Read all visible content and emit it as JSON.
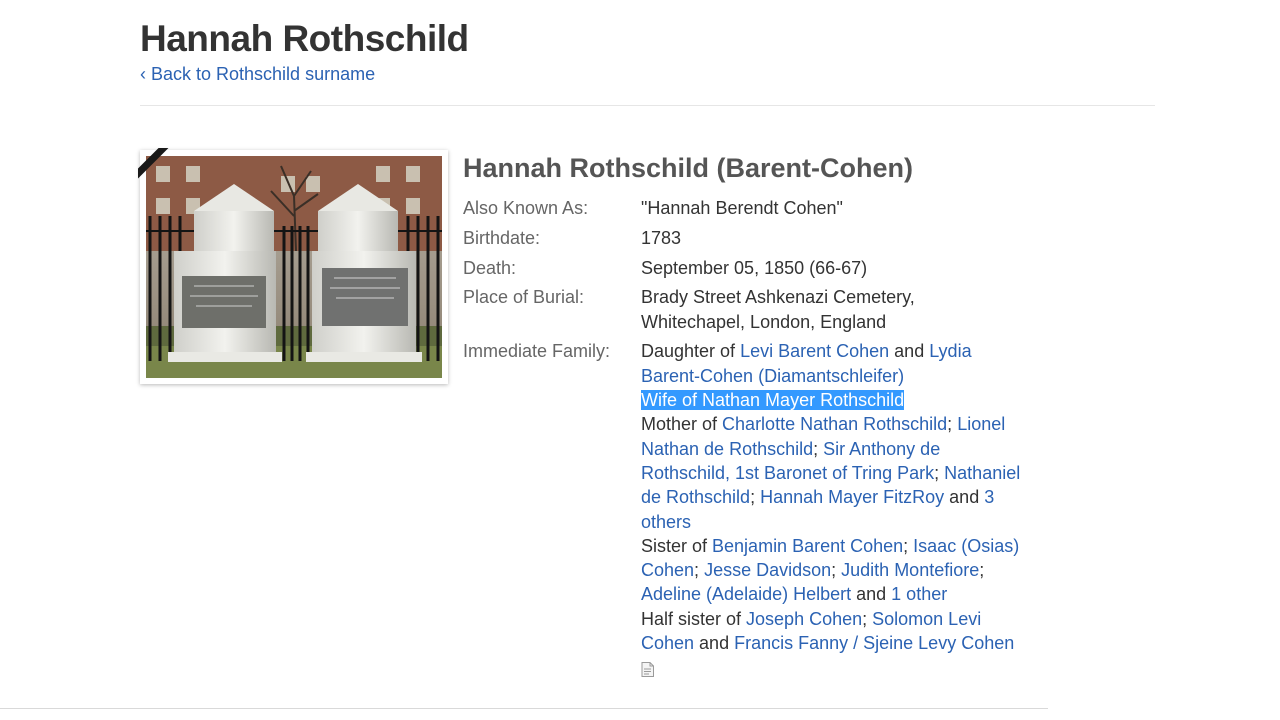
{
  "header": {
    "title": "Hannah Rothschild",
    "back_link": "‹ Back to Rothschild surname"
  },
  "profile": {
    "name": "Hannah Rothschild (Barent-Cohen)",
    "photo_icon": "gravestone-photo",
    "also_known_as_label": "Also Known As:",
    "also_known_as": "\"Hannah Berendt Cohen\"",
    "birthdate_label": "Birthdate:",
    "birthdate": "1783",
    "death_label": "Death:",
    "death": "September 05, 1850 (66-67)",
    "burial_label": "Place of Burial:",
    "burial_line1": "Brady Street Ashkenazi Cemetery,",
    "burial_line2": "Whitechapel, London, England",
    "family_label": "Immediate Family:"
  },
  "family": {
    "daughter_of": "Daughter of ",
    "parent1": "Levi Barent Cohen",
    "and1": " and ",
    "parent2": "Lydia Barent-Cohen (Diamantschleifer)",
    "wife_of": "Wife of Nathan Mayer Rothschild",
    "mother_of": "Mother of ",
    "child1": "Charlotte Nathan Rothschild",
    "sep": "; ",
    "child2": "Lionel Nathan de Rothschild",
    "child3": "Sir Anthony de Rothschild, 1st Baronet of Tring Park",
    "child4": "Nathaniel de Rothschild",
    "child5": "Hannah Mayer FitzRoy",
    "and2": " and ",
    "children_more": "3 others",
    "sister_of": "Sister of ",
    "sib1": "Benjamin Barent Cohen",
    "sib2": "Isaac (Osias) Cohen",
    "sib3": "Jesse Davidson",
    "sib4": "Judith Montefiore",
    "sib5": "Adeline (Adelaide) Helbert",
    "and3": " and ",
    "sibs_more": "1 other",
    "half_sister_of": "Half sister of ",
    "half1": "Joseph Cohen",
    "half2": "Solomon Levi Cohen",
    "and4": " and ",
    "half3": "Francis Fanny / Sjeine Levy Cohen",
    "doc_icon": "document-icon"
  },
  "colors": {
    "link": "#2b62b3",
    "highlight": "#3399ff"
  }
}
